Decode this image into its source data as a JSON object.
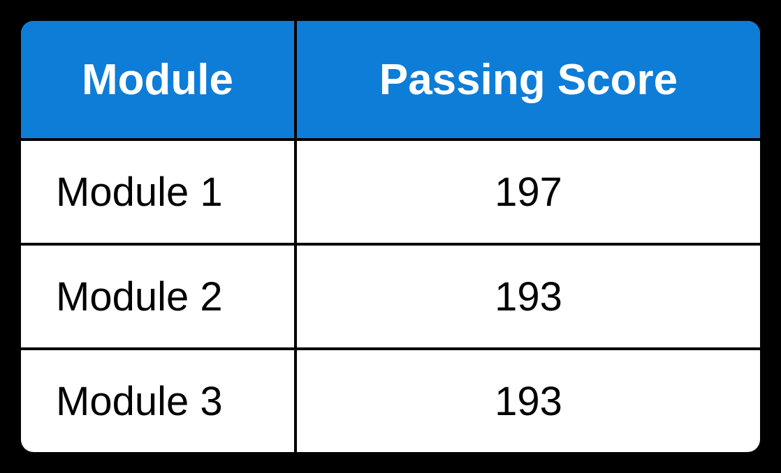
{
  "chart_data": {
    "type": "table",
    "headers": [
      "Module",
      "Passing Score"
    ],
    "rows": [
      {
        "module": "Module 1",
        "score": 197
      },
      {
        "module": "Module 2",
        "score": 193
      },
      {
        "module": "Module 3",
        "score": 193
      }
    ]
  },
  "table": {
    "header_module": "Module",
    "header_score": "Passing Score",
    "row1_module": "Module 1",
    "row1_score": "197",
    "row2_module": "Module 2",
    "row2_score": "193",
    "row3_module": "Module 3",
    "row3_score": "193"
  }
}
